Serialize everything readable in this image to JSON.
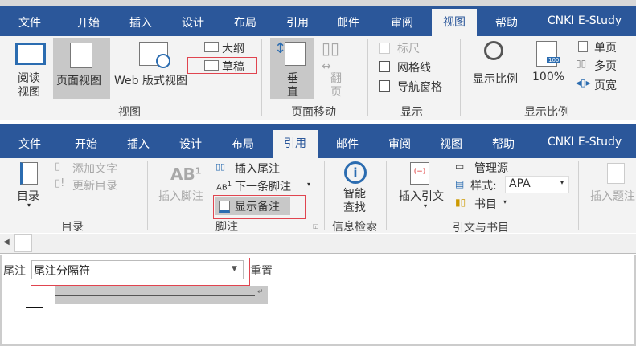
{
  "view_ribbon": {
    "tabs": [
      "文件",
      "开始",
      "插入",
      "设计",
      "布局",
      "引用",
      "邮件",
      "审阅",
      "视图",
      "帮助",
      "CNKI E-Study"
    ],
    "active_tab": "视图",
    "read_view": [
      "阅读",
      "视图"
    ],
    "print_layout": "页面视图",
    "web_layout": "Web 版式视图",
    "outline": "大纲",
    "draft": "草稿",
    "group_views": "视图",
    "vertical": [
      "垂",
      "直"
    ],
    "side_to_side": [
      "翻",
      "页"
    ],
    "group_page_move": "页面移动",
    "ruler": "标尺",
    "gridlines": "网格线",
    "nav_pane": "导航窗格",
    "group_show": "显示",
    "zoom": "显示比例",
    "zoom_100": "100%",
    "zoom_badge": "100",
    "one_page": "单页",
    "multi_page": "多页",
    "page_width": "页宽",
    "group_zoom": "显示比例"
  },
  "ref_ribbon": {
    "tabs": [
      "文件",
      "开始",
      "插入",
      "设计",
      "布局",
      "引用",
      "邮件",
      "审阅",
      "视图",
      "帮助",
      "CNKI E-Study"
    ],
    "active_tab": "引用",
    "toc": "目录",
    "add_text": "添加文字",
    "update_toc": "更新目录",
    "group_toc": "目录",
    "insert_footnote": "插入脚注",
    "ab_icon": "AB",
    "insert_endnote": "插入尾注",
    "next_footnote": "下一条脚注",
    "show_notes": "显示备注",
    "group_footnotes": "脚注",
    "smart_lookup": [
      "智能",
      "查找"
    ],
    "group_research": "信息检索",
    "insert_citation": "插入引文",
    "manage_sources": "管理源",
    "style_label": "样式:",
    "style_value": "APA",
    "bibliography": "书目",
    "group_citations": "引文与书目",
    "insert_caption": "插入题注"
  },
  "notes_pane": {
    "label": "尾注",
    "dropdown_value": "尾注分隔符",
    "reset": "重置",
    "separator_mark": "—"
  },
  "colors": {
    "accent": "#2b579a",
    "highlight": "#e0444f"
  }
}
